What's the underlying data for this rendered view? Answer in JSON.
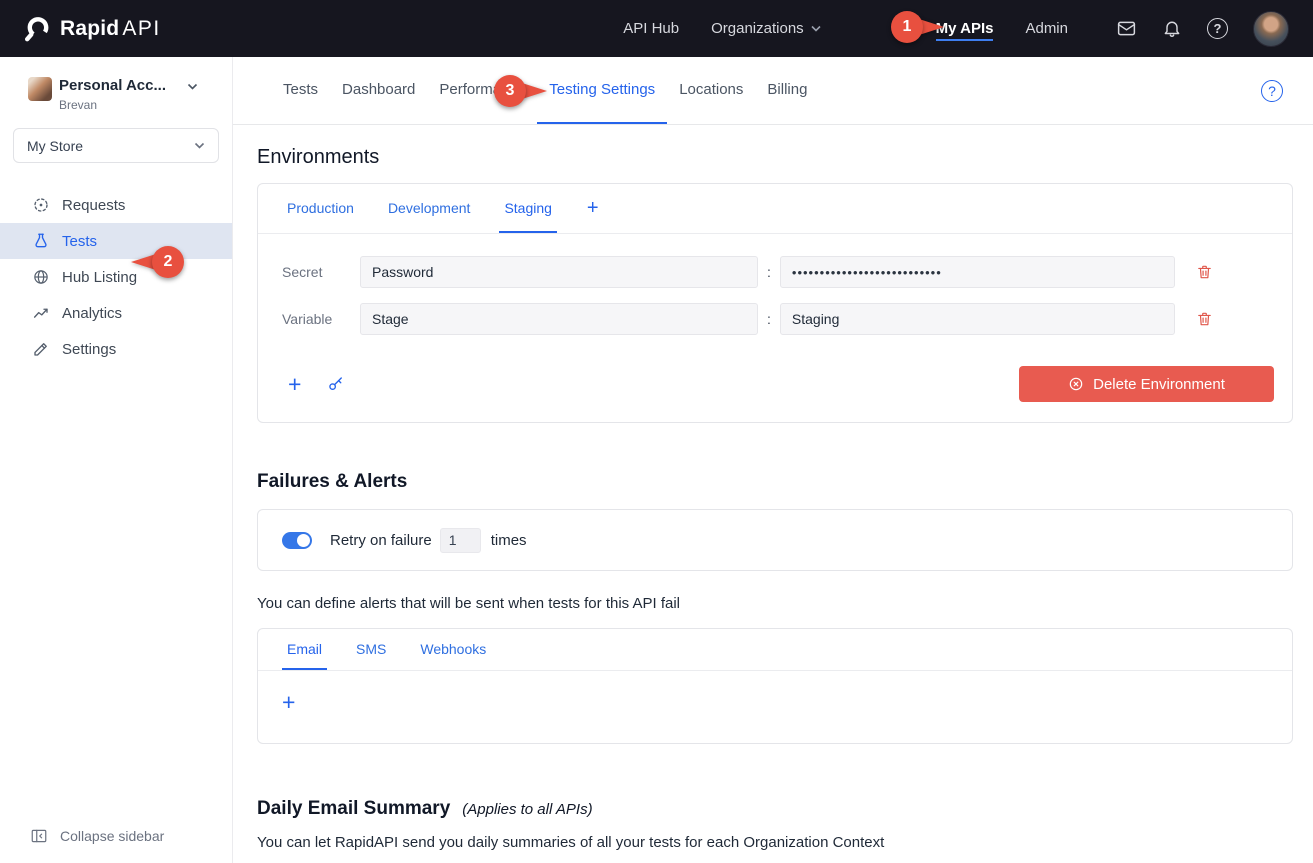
{
  "colors": {
    "accent_blue": "#2563eb",
    "danger_red": "#e8564a",
    "navbar_bg": "#16161f",
    "sidebar_active_bg": "#dfe5f1",
    "annotation_red": "#e8503f"
  },
  "navbar": {
    "brand_bold": "Rapid",
    "brand_light": "API",
    "items": [
      {
        "label": "API Hub",
        "active": false
      },
      {
        "label": "Organizations",
        "active": false,
        "has_chevron": true
      },
      {
        "label": "My APIs",
        "active": true
      },
      {
        "label": "Admin",
        "active": false
      }
    ],
    "icons": [
      "inbox-icon",
      "bell-icon",
      "help-icon",
      "user-avatar"
    ]
  },
  "sidebar": {
    "account": {
      "name": "Personal Acc...",
      "username": "Brevan"
    },
    "store_select": {
      "value": "My Store"
    },
    "items": [
      {
        "label": "Requests",
        "icon": "radar-icon",
        "active": false
      },
      {
        "label": "Tests",
        "icon": "flask-icon",
        "active": true
      },
      {
        "label": "Hub Listing",
        "icon": "globe-icon",
        "active": false
      },
      {
        "label": "Analytics",
        "icon": "chart-icon",
        "active": false
      },
      {
        "label": "Settings",
        "icon": "pencil-icon",
        "active": false
      }
    ],
    "collapse_label": "Collapse sidebar"
  },
  "main": {
    "tabs": [
      {
        "label": "Tests",
        "active": false
      },
      {
        "label": "Dashboard",
        "active": false
      },
      {
        "label": "Performance",
        "active": false
      },
      {
        "label": "Testing Settings",
        "active": true
      },
      {
        "label": "Locations",
        "active": false
      },
      {
        "label": "Billing",
        "active": false
      }
    ]
  },
  "environments": {
    "title": "Environments",
    "tabs": [
      {
        "label": "Production",
        "active": false
      },
      {
        "label": "Development",
        "active": false
      },
      {
        "label": "Staging",
        "active": true
      }
    ],
    "separator": ":",
    "rows": [
      {
        "label": "Secret",
        "key": "Password",
        "value": "•••••••••••••••••••••••••••",
        "masked": true
      },
      {
        "label": "Variable",
        "key": "Stage",
        "value": "Staging",
        "masked": false
      }
    ],
    "delete_button_label": "Delete Environment"
  },
  "failures": {
    "title": "Failures & Alerts",
    "retry_toggle_on": true,
    "retry_text_before": "Retry on failure",
    "retry_count": "1",
    "retry_text_after": "times",
    "alerts_hint": "You can define alerts that will be sent when tests for this API fail",
    "alert_tabs": [
      {
        "label": "Email",
        "active": true
      },
      {
        "label": "SMS",
        "active": false
      },
      {
        "label": "Webhooks",
        "active": false
      }
    ]
  },
  "daily_summary": {
    "title": "Daily Email Summary",
    "note": "(Applies to all APIs)",
    "description": "You can let RapidAPI send you daily summaries of all your tests for each Organization Context"
  },
  "annotations": [
    {
      "number": "1",
      "target": "My APIs"
    },
    {
      "number": "2",
      "target": "Tests"
    },
    {
      "number": "3",
      "target": "Testing Settings"
    }
  ],
  "glyphs": {
    "plus": "+",
    "question_mark": "?"
  }
}
